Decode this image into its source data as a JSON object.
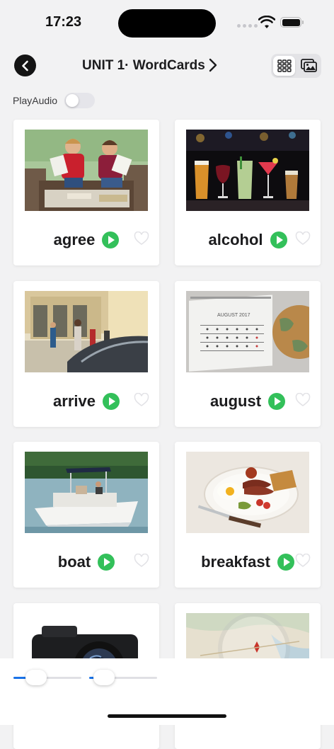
{
  "status_bar": {
    "time": "17:23"
  },
  "nav": {
    "back_icon": "chevron-left-icon",
    "title": "UNIT 1· WordCards",
    "title_chevron_icon": "chevron-right-icon",
    "view_modes": [
      {
        "name": "grid",
        "icon": "grid-icon",
        "selected": true
      },
      {
        "name": "images",
        "icon": "images-icon",
        "selected": false
      }
    ]
  },
  "play_audio": {
    "label": "PlayAudio",
    "enabled": false
  },
  "cards": [
    {
      "word": "agree",
      "image": "two-students-reading-photo",
      "favorite": false
    },
    {
      "word": "alcohol",
      "image": "cocktail-glasses-photo",
      "favorite": false
    },
    {
      "word": "arrive",
      "image": "students-walking-photo",
      "favorite": false
    },
    {
      "word": "august",
      "image": "calendar-globe-photo",
      "favorite": false
    },
    {
      "word": "boat",
      "image": "motorboat-photo",
      "favorite": false
    },
    {
      "word": "breakfast",
      "image": "breakfast-plate-photo",
      "favorite": false
    },
    {
      "word": "",
      "image": "camera-photo",
      "favorite": false
    },
    {
      "word": "",
      "image": "map-photo",
      "favorite": false
    }
  ],
  "sliders": [
    {
      "name": "text-size",
      "value": 0.27
    },
    {
      "name": "image-size",
      "value": 0.15
    }
  ],
  "colors": {
    "accent": "#1a73e8",
    "play_button": "#33c05a",
    "background": "#f2f2f3"
  }
}
